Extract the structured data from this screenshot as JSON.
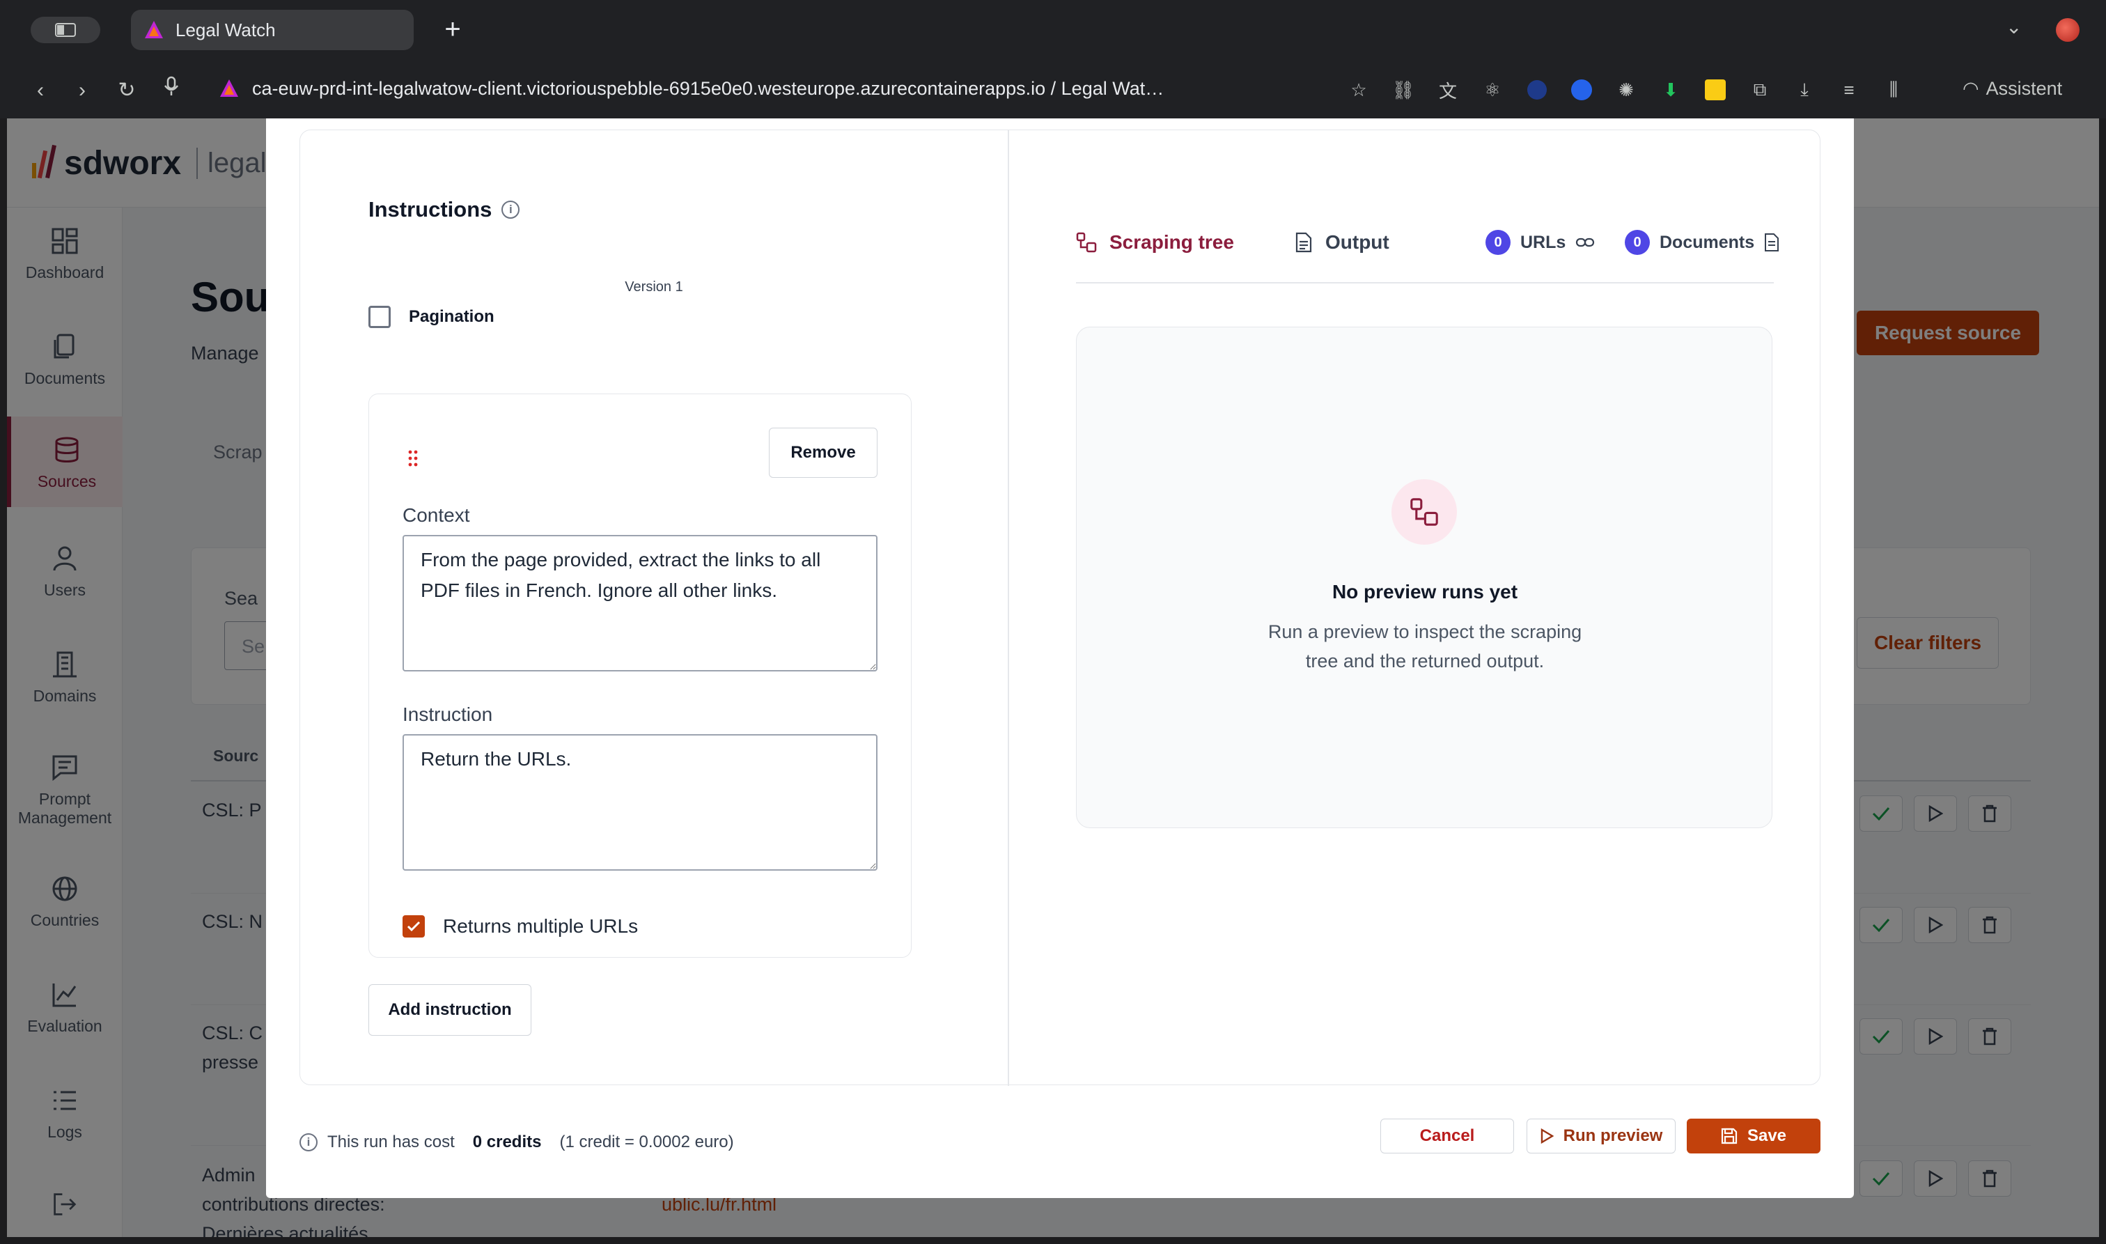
{
  "browser": {
    "tab_title": "Legal Watch",
    "url": "ca-euw-prd-int-legalwatow-client.victoriouspebble-6915e0e0.westeurope.azurecontainerapps.io  /  Legal Wat…",
    "assistant_label": "Assistent"
  },
  "app": {
    "logo_brand": "sdworx",
    "logo_product": "legal wa",
    "sidebar": {
      "items": [
        {
          "label": "Dashboard",
          "icon": "dashboard-icon"
        },
        {
          "label": "Documents",
          "icon": "documents-icon"
        },
        {
          "label": "Sources",
          "icon": "database-icon"
        },
        {
          "label": "Users",
          "icon": "user-icon"
        },
        {
          "label": "Domains",
          "icon": "building-icon"
        },
        {
          "label": "Prompt Management",
          "icon": "chat-icon"
        },
        {
          "label": "Countries",
          "icon": "globe-icon"
        },
        {
          "label": "Evaluation",
          "icon": "chart-icon"
        },
        {
          "label": "Logs",
          "icon": "list-icon"
        }
      ],
      "active": "Sources"
    },
    "page_title": "Sou",
    "page_subtitle": "Manage",
    "tab_fragment": "Scrap",
    "search_fragment": "Sea",
    "input_fragment": "Se",
    "column_fragment": "Sourc",
    "rows": [
      {
        "name": "CSL: P"
      },
      {
        "name": "CSL: N"
      },
      {
        "name": "CSL: C",
        "line2": "presse"
      },
      {
        "name": "Admin",
        "line2": "contributions directes:",
        "line3": "Dernières actualités",
        "url": "ublic.lu/fr.html"
      }
    ],
    "request_source_label": "Request source",
    "clear_filters_label": "Clear filters"
  },
  "modal": {
    "instructions_title": "Instructions",
    "version_label": "Version 1",
    "pagination_label": "Pagination",
    "pagination_checked": false,
    "instruction_card": {
      "remove_label": "Remove",
      "context_label": "Context",
      "context_value": "From the page provided, extract the links to all PDF files in French. Ignore all other links.",
      "instruction_label": "Instruction",
      "instruction_value": "Return the URLs.",
      "returns_multiple_label": "Returns multiple URLs",
      "returns_multiple_checked": true
    },
    "add_instruction_label": "Add instruction",
    "tabs": {
      "scraping_tree": "Scraping tree",
      "output": "Output",
      "urls_count": "0",
      "urls_label": "URLs",
      "documents_count": "0",
      "documents_label": "Documents"
    },
    "empty_state": {
      "title": "No preview runs yet",
      "description": "Run a preview to inspect the scraping tree and the returned output."
    },
    "footer": {
      "cost_prefix": "This run has cost",
      "credits": "0 credits",
      "rate": "(1 credit = 0.0002 euro)",
      "cancel_label": "Cancel",
      "run_preview_label": "Run preview",
      "save_label": "Save"
    }
  },
  "colors": {
    "accent": "#8b1d3d",
    "primary_button": "#c2410c",
    "badge": "#4f46e5"
  }
}
